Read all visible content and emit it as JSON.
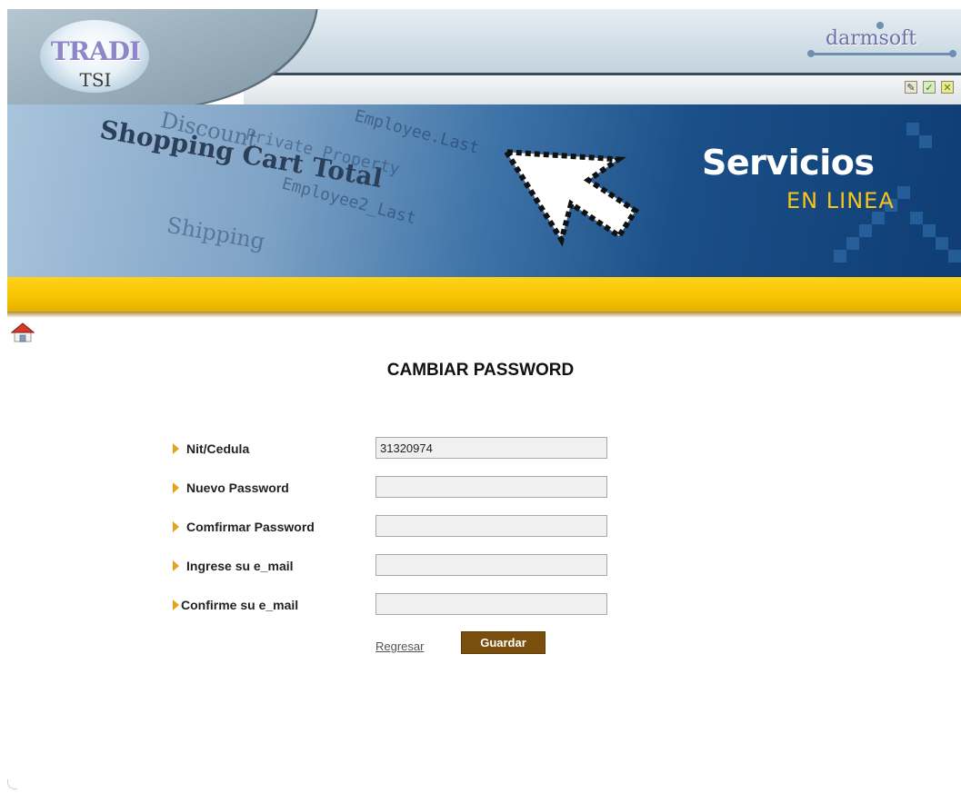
{
  "header": {
    "logo_text": "TRADI",
    "logo_sub": "TSI",
    "brand": "darmsoft",
    "window_icons": [
      "edit-icon",
      "check-icon",
      "close-icon"
    ]
  },
  "banner": {
    "title": "Servicios",
    "subtitle": "EN LINEA",
    "background_words": [
      "Discount",
      "Shopping Cart Total",
      "Private Property",
      "Shipping",
      "Employee.Last",
      "Employee2_Last"
    ]
  },
  "nav": {
    "home_icon": "home-icon"
  },
  "form": {
    "title": "CAMBIAR PASSWORD",
    "fields": [
      {
        "label": "Nit/Cedula",
        "value": "31320974"
      },
      {
        "label": "Nuevo Password",
        "value": ""
      },
      {
        "label": "Comfirmar Password",
        "value": ""
      },
      {
        "label": "Ingrese su e_mail",
        "value": ""
      },
      {
        "label": "Confirme su e_mail",
        "value": ""
      }
    ],
    "back_label": "Regresar",
    "save_label": "Guardar"
  },
  "colors": {
    "accent_yellow": "#f6c400",
    "banner_blue": "#1b4f88",
    "button_brown": "#7a4f0d",
    "arrow_orange": "#e5a21c"
  }
}
